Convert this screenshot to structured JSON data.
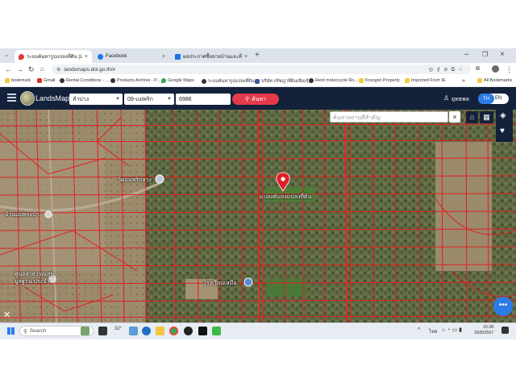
{
  "browser": {
    "tabs": [
      {
        "label": "ระบบค้นหารูปแปลงที่ดิน (LandsMa",
        "active": true,
        "icon_color": "#e53935"
      },
      {
        "label": "Facebook",
        "active": false,
        "icon_color": "#1877f2"
      },
      {
        "label": "ผลประกาศซื้อขายบ้านและที่ดินฟรี |",
        "active": false,
        "icon_color": "#1a73e8"
      }
    ],
    "new_tab_label": "+",
    "url": "landsmaps.dol.go.th/#",
    "bookmarks": [
      {
        "label": "bookmark",
        "color": "#777"
      },
      {
        "label": "Gmail",
        "color": "#d93025"
      },
      {
        "label": "Rental Conditions - ...",
        "color": "#333"
      },
      {
        "label": "Products Archive - P...",
        "color": "#333"
      },
      {
        "label": "Google Maps",
        "color": "#34a853"
      },
      {
        "label": "ระบบค้นหารูปแปลงที่ดิน",
        "color": "#333"
      },
      {
        "label": "บริษัท ปรัชญาที่ดินเชียงรุ้...",
        "color": "#3b5998"
      },
      {
        "label": "Rent motorcycle Ro...",
        "color": "#333"
      },
      {
        "label": "Krungsri Property",
        "color": "#c9a400"
      },
      {
        "label": "Imported From IE",
        "color": "#c9a400"
      },
      {
        "label": "»",
        "color": "#333"
      },
      {
        "label": "All Bookmarks",
        "color": "#777"
      }
    ]
  },
  "app": {
    "logo_text": "LandsMaps",
    "province": "ลำปาง",
    "district": "09-แม่พริก",
    "parcel_number": "6986",
    "search_button": "ค้นหา",
    "user_name": "ยุทธพล",
    "lang_th": "TH",
    "lang_en": "EN",
    "colors": {
      "header": "#13213a",
      "search_button": "#e53a4a",
      "parcel_lines": "#e02020",
      "lang_active": "#2d7be5"
    }
  },
  "map": {
    "place_search_placeholder": "ค้นหาสถานที่สำคัญ",
    "clear_icon": "close-icon",
    "labels": {
      "parcel": "แปลงค้นจงแปลงที่ดิน",
      "temple": "วัดแม่พริกลาง",
      "village": "บ้านแม่พระบ้า",
      "health_center": "ศูนย์สาธารณสุขมูลฐาน ประจำ",
      "school": "โรงเรียนเสมือ"
    }
  },
  "taskbar": {
    "search_label": "Search",
    "weather": "32°",
    "language": "ไทย",
    "time": "15:36",
    "date": "28/8/2567"
  }
}
